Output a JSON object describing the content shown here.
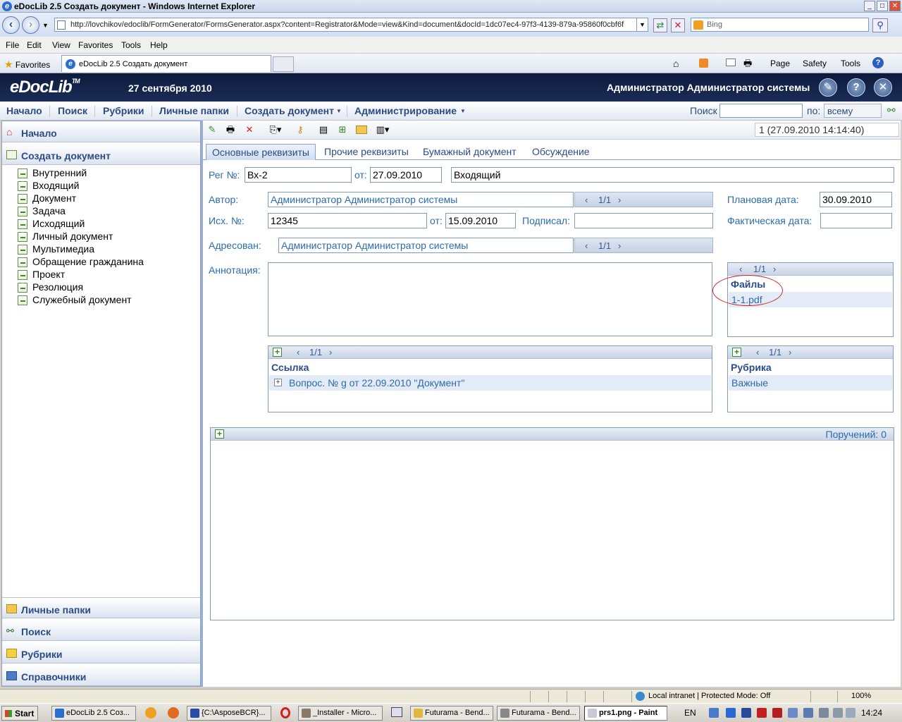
{
  "window": {
    "title": "eDocLib 2.5 Создать документ - Windows Internet Explorer"
  },
  "browser": {
    "url": "http://lovchikov/edoclib/FormGenerator/FormsGenerator.aspx?content=Registrator&Mode=view&Kind=document&docId=1dc07ec4-97f3-4139-879a-95860f0cbf6f",
    "search_placeholder": "Bing",
    "menu": [
      "File",
      "Edit",
      "View",
      "Favorites",
      "Tools",
      "Help"
    ],
    "favorites_label": "Favorites",
    "tab_title": "eDocLib 2.5 Создать документ",
    "commands": [
      "Page",
      "Safety",
      "Tools"
    ]
  },
  "app": {
    "logo": "eDocLib",
    "logo_tm": "TM",
    "date": "27 сентября 2010",
    "user": "Администратор Администратор системы",
    "nav": [
      "Начало",
      "Поиск",
      "Рубрики",
      "Личные папки",
      "Создать документ",
      "Администрирование"
    ],
    "search_label": "Поиск",
    "search_scope_label": "по:",
    "search_scope_value": "всему"
  },
  "sidebar": {
    "top": [
      {
        "label": "Начало"
      },
      {
        "label": "Создать документ"
      }
    ],
    "items": [
      "Внутренний",
      "Входящий",
      "Документ",
      "Задача",
      "Исходящий",
      "Личный документ",
      "Мультимедиа",
      "Обращение гражданина",
      "Проект",
      "Резолюция",
      "Служебный документ"
    ],
    "bottom": [
      {
        "label": "Личные папки"
      },
      {
        "label": "Поиск"
      },
      {
        "label": "Рубрики"
      },
      {
        "label": "Справочники"
      }
    ]
  },
  "doc": {
    "version": "1   (27.09.2010 14:14:40)",
    "tabs": [
      "Основные реквизиты",
      "Прочие реквизиты",
      "Бумажный документ",
      "Обсуждение"
    ],
    "reg_label": "Рег №:",
    "reg_value": "Вх-2",
    "from_label": "от:",
    "reg_date": "27.09.2010",
    "kind": "Входящий",
    "author_label": "Автор:",
    "author": "Администратор Администратор системы",
    "author_pager": "1/1",
    "planned_label": "Плановая дата:",
    "planned_date": "30.09.2010",
    "out_label": "Исх. №:",
    "out_value": "12345",
    "out_date": "15.09.2010",
    "signed_label": "Подписал:",
    "signed_value": "",
    "actual_label": "Фактическая дата:",
    "actual_date": "",
    "addressed_label": "Адресован:",
    "addressed": "Администратор Администратор системы",
    "addressed_pager": "1/1",
    "annotation_label": "Аннотация:",
    "files": {
      "pager": "1/1",
      "title": "Файлы",
      "items": [
        "1-1.pdf"
      ]
    },
    "links": {
      "pager": "1/1",
      "title": "Ссылка",
      "items": [
        "Вопрос. № g от 22.09.2010 \"Документ\""
      ]
    },
    "rubric": {
      "pager": "1/1",
      "title": "Рубрика",
      "items": [
        "Важные"
      ]
    },
    "tasks_label": "Поручений: 0"
  },
  "status": {
    "zone": "Local intranet | Protected Mode: Off",
    "zoom": "100%"
  },
  "taskbar": {
    "start": "Start",
    "tasks": [
      "eDocLib 2.5 Соз...",
      "{C:\\AsposeBCR}...",
      "_Installer - Micro...",
      "Futurama - Bend...",
      "Futurama - Bend...",
      "prs1.png - Paint"
    ],
    "lang": "EN",
    "time": "14:24"
  }
}
